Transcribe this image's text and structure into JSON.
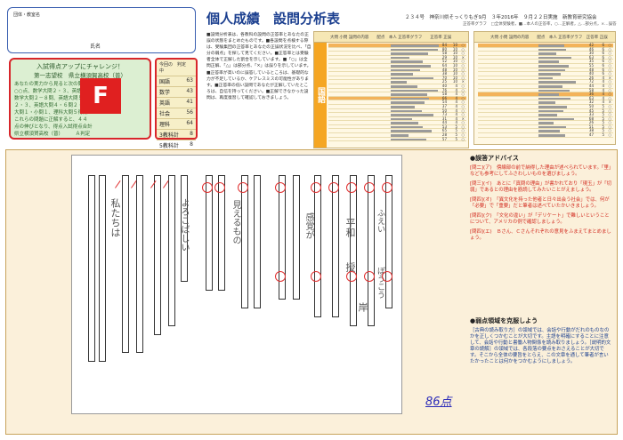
{
  "student": {
    "school_label": "団体・教室名",
    "name_label": "氏名"
  },
  "rank": {
    "caption1": "入試得点アップにチャレンジ！",
    "caption2": "第一志望校　県立横須賀高校（普）",
    "lines": [
      "あなたの実力から見ると次の問題が",
      "○○点、数学大問２・３、英語大問",
      "数学大問２－８問、英語大問５－５",
      "２・３、英語大問４・６問２・２問",
      "大問１・小問１、理科大問５得点",
      "",
      "これらの問題に正解すると、４４",
      "点の伸びとなり、得点入試得点合計",
      "県立横須賀高校（普）　　　Ａ判定"
    ],
    "grade": "F"
  },
  "subjects": {
    "header": "今回の　判定　中",
    "rows": [
      {
        "name": "国語",
        "value": "63"
      },
      {
        "name": "数学",
        "value": "43"
      },
      {
        "name": "英語",
        "value": "41"
      },
      {
        "name": "社会",
        "value": "56"
      },
      {
        "name": "理科",
        "value": "64"
      },
      {
        "name": "3教科計",
        "value": "8"
      },
      {
        "name": "5教科計",
        "value": "8"
      }
    ]
  },
  "header": {
    "title": "個人成績　設問分析表",
    "exam_info": "２３４号　神奈川県そっくりもぎ9月　３年2016年　９月２２日実施　新教育研究協会",
    "legend": "正答率グラフ　□全体受験者，■…本人の正答率，○…正解者，△…部分点，×…誤答"
  },
  "explain": "■設問分析表は、各教科の設問の正答率とあなたの正誤の状態をまとめたものです。■各設問を点検する際は、受験集団の正答率とあなたの正誤状況を比べ、「自分の弱点」を探して見てください。■正答率とは受験者全体で正解した割合を示しています。■「○」は全問正解、「△」は部分点、「×」は誤りを示しています。■正答率が高いのに誤答しているところは、基礎的な力が不足しているか、ケアレスミスの可能性があります。■正答率の低い設問であなたが正解していたところは、自信を持ってください。■正解できなかった設問は、再度復習して確認しておきましょう。",
  "table_left": {
    "side": "国語",
    "head": "大問 小問 設問の内容　　配点　本人 正答率グラフ　　正答率 正誤",
    "rows": [
      {
        "v": 90,
        "n1": "84",
        "n2": "10",
        "mk": "○",
        "hl": true
      },
      {
        "v": 88,
        "n1": "80",
        "n2": "10",
        "mk": "○",
        "hl": false
      },
      {
        "v": 70,
        "n1": "58",
        "n2": "10",
        "mk": "○",
        "hl": false
      },
      {
        "v": 35,
        "n1": "29",
        "n2": "10",
        "mk": "×",
        "hl": false
      },
      {
        "v": 60,
        "n1": "52",
        "n2": "10",
        "mk": "○",
        "hl": false
      },
      {
        "v": 75,
        "n1": "64",
        "n2": "10",
        "mk": "○",
        "hl": false
      },
      {
        "v": 55,
        "n1": "48",
        "n2": "10",
        "mk": "○",
        "hl": false
      },
      {
        "v": 42,
        "n1": "38",
        "n2": "10",
        "mk": "○",
        "hl": false
      },
      {
        "v": 80,
        "n1": "70",
        "n2": "10",
        "mk": "○",
        "hl": false
      },
      {
        "v": 30,
        "n1": "25",
        "n2": "10",
        "mk": "×",
        "hl": false
      },
      {
        "v": 50,
        "n1": "40",
        "n2": "4",
        "mk": "○",
        "hl": false
      },
      {
        "v": 88,
        "n1": "76",
        "n2": "4",
        "mk": "○",
        "hl": false
      },
      {
        "v": 68,
        "n1": "58",
        "n2": "4",
        "mk": "○",
        "hl": false
      },
      {
        "v": 72,
        "n1": "66",
        "n2": "4",
        "mk": "○",
        "hl": true
      },
      {
        "v": 64,
        "n1": "54",
        "n2": "4",
        "mk": "○",
        "hl": false
      },
      {
        "v": 45,
        "n1": "37",
        "n2": "4",
        "mk": "○",
        "hl": false
      },
      {
        "v": 58,
        "n1": "50",
        "n2": "4",
        "mk": "○",
        "hl": false
      },
      {
        "v": 80,
        "n1": "73",
        "n2": "4",
        "mk": "○",
        "hl": false
      },
      {
        "v": 40,
        "n1": "31",
        "n2": "4",
        "mk": "×",
        "hl": false
      },
      {
        "v": 52,
        "n1": "44",
        "n2": "4",
        "mk": "○",
        "hl": false
      },
      {
        "v": 60,
        "n1": "53",
        "n2": "5",
        "mk": "○",
        "hl": false
      },
      {
        "v": 76,
        "n1": "65",
        "n2": "5",
        "mk": "○",
        "hl": false
      },
      {
        "v": 34,
        "n1": "28",
        "n2": "5",
        "mk": "○",
        "hl": false
      },
      {
        "v": 66,
        "n1": "57",
        "n2": "5",
        "mk": "○",
        "hl": false
      }
    ]
  },
  "table_right": {
    "head": "大問 小問 設問の内容　　配点　本人 正答率グラフ　正答率 正誤",
    "rows": [
      {
        "v": 55,
        "n1": "42",
        "n2": "6",
        "mk": "○",
        "hl": true
      },
      {
        "v": 60,
        "n1": "46",
        "n2": "6",
        "mk": "○",
        "hl": false
      },
      {
        "v": 38,
        "n1": "30",
        "n2": "6",
        "mk": "○",
        "hl": false
      },
      {
        "v": 72,
        "n1": "63",
        "n2": "6",
        "mk": "○",
        "hl": false
      },
      {
        "v": 45,
        "n1": "35",
        "n2": "6",
        "mk": "○",
        "hl": false
      },
      {
        "v": 66,
        "n1": "55",
        "n2": "6",
        "mk": "○",
        "hl": false
      },
      {
        "v": 58,
        "n1": "48",
        "n2": "6",
        "mk": "○",
        "hl": false
      },
      {
        "v": 48,
        "n1": "40",
        "n2": "6",
        "mk": "○",
        "hl": false
      },
      {
        "v": 30,
        "n1": "26",
        "n2": "4",
        "mk": "×",
        "hl": false
      },
      {
        "v": 80,
        "n1": "72",
        "n2": "4",
        "mk": "○",
        "hl": false
      },
      {
        "v": 52,
        "n1": "44",
        "n2": "4",
        "mk": "○",
        "hl": false
      },
      {
        "v": 68,
        "n1": "58",
        "n2": "4",
        "mk": "○",
        "hl": false
      },
      {
        "v": 44,
        "n1": "36",
        "n2": "4",
        "mk": "○",
        "hl": true
      },
      {
        "v": 70,
        "n1": "63",
        "n2": "4",
        "mk": "○",
        "hl": false
      },
      {
        "v": 36,
        "n1": "32",
        "n2": "4",
        "mk": "×",
        "hl": false
      },
      {
        "v": 62,
        "n1": "50",
        "n2": "5",
        "mk": "○",
        "hl": false
      },
      {
        "v": 54,
        "n1": "45",
        "n2": "5",
        "mk": "○",
        "hl": false
      },
      {
        "v": 40,
        "n1": "33",
        "n2": "5",
        "mk": "○",
        "hl": false
      },
      {
        "v": 76,
        "n1": "68",
        "n2": "5",
        "mk": "○",
        "hl": false
      },
      {
        "v": 32,
        "n1": "26",
        "n2": "5",
        "mk": "○",
        "hl": false
      },
      {
        "v": 60,
        "n1": "51",
        "n2": "5",
        "mk": "○",
        "hl": false
      },
      {
        "v": 46,
        "n1": "38",
        "n2": "5",
        "mk": "○",
        "hl": false
      },
      {
        "v": 58,
        "n1": "47",
        "n2": "5",
        "mk": "○",
        "hl": false
      }
    ]
  },
  "advice": {
    "heading": "●誤答アドバイス",
    "items": [
      "[問二](ア)　傍線部の前で納得した理由が述べられています。「里」なども参考にしてふさわしいものを選びましょう。",
      "[問三](イ)　あとに「真問の理由」が書かれており「現玉」が「切弱」であるとの理由を筋読してみたいことがえましょう。",
      "[問四](オ)　「異文化を持った他者と日々出会う社会」では、何が「必要」で「重要」だと筆者は述べていたかいきましょう。",
      "[問四](ク)　「文化の違い」が「デリケート」で難しいということについて、アメリカの例で確認しましょう。",
      "[問四](エ)　Ｂさん、Ｃさんそれぞれの意見をふまえてまとめましょう。"
    ]
  },
  "weak": {
    "heading": "●弱点領域を克服しよう",
    "text": "［古典の読み取り方］の領域では、会話や行動がだれのものなのかを正しくつかむことが大切です。主語を明確にすることに注意して、会話や行動と書働人物関係を読み取りましょう。［説明的文章の読解］の領域では、各段落の要点をおさえることが大切です。そこから全体の要旨をとらえ、この文章を通して筆者が言いたかったことは何かをつかむようにしましょう。"
  },
  "score": "86点",
  "sheet": {
    "answers": [
      "私たちは",
      "よろこばしい",
      "見えるもの",
      "感覚が",
      "平和",
      "授",
      "岸",
      "ふえい",
      "ぼうこう"
    ]
  }
}
